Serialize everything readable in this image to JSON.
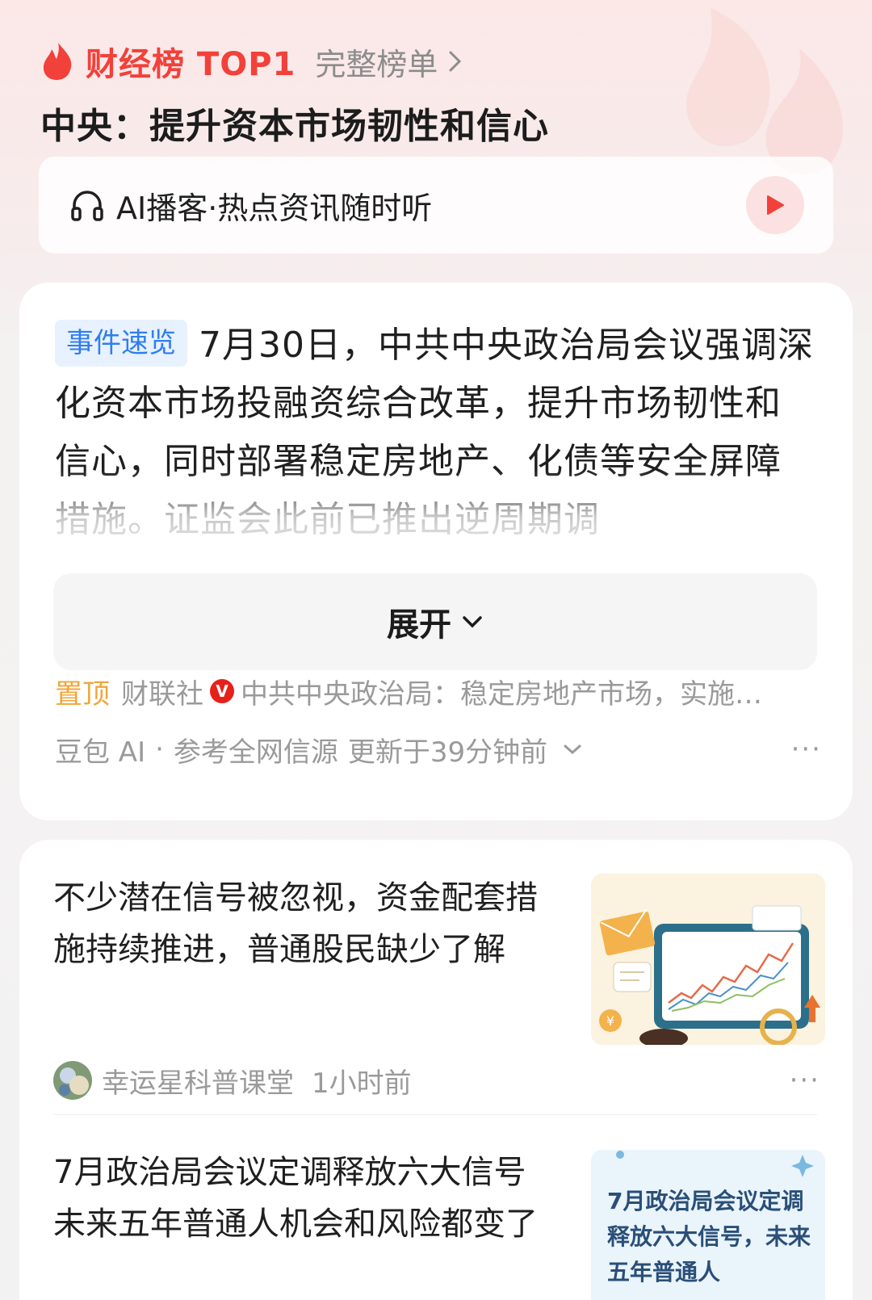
{
  "header": {
    "hot_title": "财经榜 TOP1",
    "full_list_label": "完整榜单",
    "headline": "中央：提升资本市场韧性和信心"
  },
  "podcast": {
    "label": "AI播客·热点资讯随时听"
  },
  "event_card": {
    "tag": "事件速览",
    "summary": "7月30日，中共中央政治局会议强调深化资本市场投融资综合改革，提升市场韧性和信心，同时部署稳定房地产、化债等安全屏障措施。证监会此前已推出逆周期调",
    "expand_label": "展开",
    "pinned": {
      "label": "置顶",
      "source": "财联社",
      "badge": "V",
      "text": "中共中央政治局：稳定房地产市场，实施…"
    },
    "meta": {
      "provider": "豆包 AI",
      "sources": "参考全网信源",
      "updated": "更新于39分钟前",
      "more": "···"
    }
  },
  "articles": [
    {
      "title": "不少潜在信号被忽视，资金配套措施持续推进，普通股民缺少了解",
      "author": "幸运星科普课堂",
      "time": "1小时前",
      "more": "···"
    },
    {
      "title": "7月政治局会议定调释放六大信号未来五年普通人机会和风险都变了",
      "thumb_text": "7月政治局会议定调释放六大信号，未来五年普通人"
    }
  ],
  "colors": {
    "brand_red": "#f2403a",
    "tag_blue": "#2f7ef0",
    "pin_orange": "#f0a63a"
  }
}
